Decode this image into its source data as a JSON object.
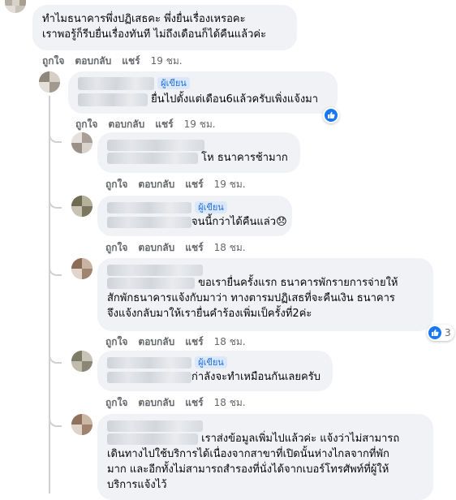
{
  "actions": {
    "like": "ถูกใจ",
    "reply": "ตอบกลับ",
    "share": "แชร์"
  },
  "author_badge": "ผู้เขียน",
  "comments": [
    {
      "lines": [
        "ทำไมธนาคารพึ่งปฏิเสธคะ พึ่งยื่นเรื่องเหรอคะ",
        "เราพอรู้ก็รีบยื่นเรื่องทันที ไม่ถึงเดือนก็ได้คืนแล้วค่ะ"
      ],
      "time": "19 ชม."
    },
    {
      "lines": [
        "ยื่นไปตั้งแต่เดือน6แล้วครับเพิ่งแจ้งมา"
      ],
      "time": "19 ชม."
    },
    {
      "lines": [
        "โห ธนาคารช้ามาก"
      ],
      "time": "19 ชม."
    },
    {
      "lines": [
        "จนนี้กว่าได้คืนแล่ว😞"
      ],
      "time": "18 ชม."
    },
    {
      "lines": [
        "ขอเรายื่นครั้งแรก ธนาคารพักรายการจ่ายให้",
        "สักพักธนาคารแจ้งกับมาว่า ทางตารมปฏิเสธที่จะคืนเงิน ธนาคาร",
        "จึงแจ้งกลับมาให้เรายื่นคำร้องเพิ่มเป็ครั้งที่2ค่ะ"
      ],
      "time": "18 ชม.",
      "reactions": "3"
    },
    {
      "lines": [
        "ก่าลังจะทำเหมือนกันเลยครับ"
      ],
      "time": "18 ชม."
    },
    {
      "lines": [
        "เราส่งข้อมูลเพิ่มไปแล้วค่ะ แจ้งว่าไม่สามารถ",
        "เดินทางไปใช้บริการได้เนื่องจากสาขาที่เปิดนั้นห่างไกลจากที่พัก",
        "มาก และอีกทั้งไม่สามารถสำรองที่นั่งได้จากเบอร์โทรศัพท์ที่ผู้ให้",
        "บริการแจ้งไว้"
      ]
    }
  ]
}
